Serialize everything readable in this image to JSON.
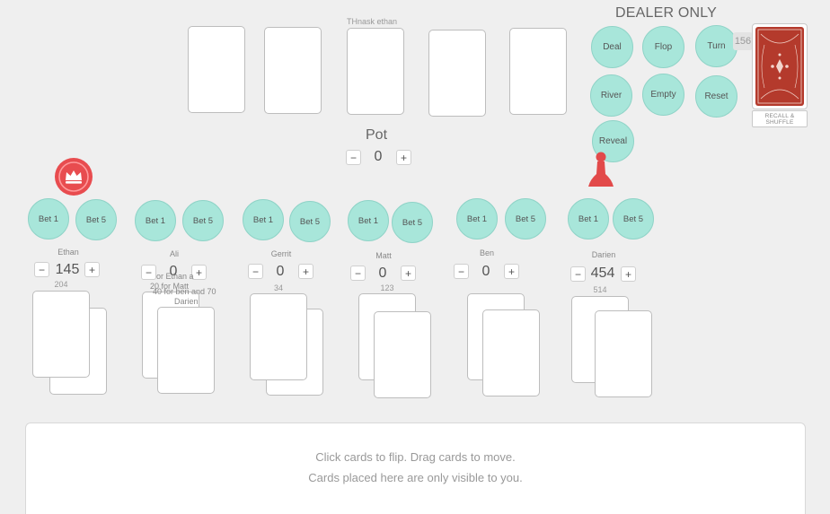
{
  "community": {
    "note": "THnask ethan"
  },
  "dealer": {
    "title": "DEALER ONLY",
    "buttons": {
      "deal": "Deal",
      "flop": "Flop",
      "turn": "Turn",
      "river": "River",
      "empty": "Empty",
      "reset": "Reset",
      "reveal": "Reveal"
    },
    "deck_count": "156",
    "recall_line1": "RECALL &",
    "recall_line2": "SHUFFLE",
    "deck_color": "#b43a2c"
  },
  "pot": {
    "label": "Pot",
    "value": "0",
    "minus": "−",
    "plus": "+"
  },
  "bet1": "Bet 1",
  "bet5": "Bet 5",
  "minus": "−",
  "plus": "+",
  "players": [
    {
      "name": "Ethan",
      "value": "145",
      "number": "204"
    },
    {
      "name": "Ali",
      "value": "0",
      "number": ""
    },
    {
      "name": "Gerrit",
      "value": "0",
      "number": "34"
    },
    {
      "name": "Matt",
      "value": "0",
      "number": "123"
    },
    {
      "name": "Ben",
      "value": "0",
      "number": ""
    },
    {
      "name": "Darien",
      "value": "454",
      "number": "514"
    }
  ],
  "ali_note": {
    "line1": "or Ethan a",
    "line2": "20 for Matt",
    "line3": "40 for ben and 70",
    "line4": "Darien"
  },
  "hand_area": {
    "line1": "Click cards to flip.   Drag cards to move.",
    "line2": "Cards placed here are only visible to you."
  },
  "colors": {
    "chip": "#a8e6da",
    "crown": "#e84c4f",
    "pawn": "#e24a4a",
    "background": "#efefef"
  },
  "icons": {
    "dealer_button": "crown-icon",
    "active_player": "pawn-icon"
  }
}
